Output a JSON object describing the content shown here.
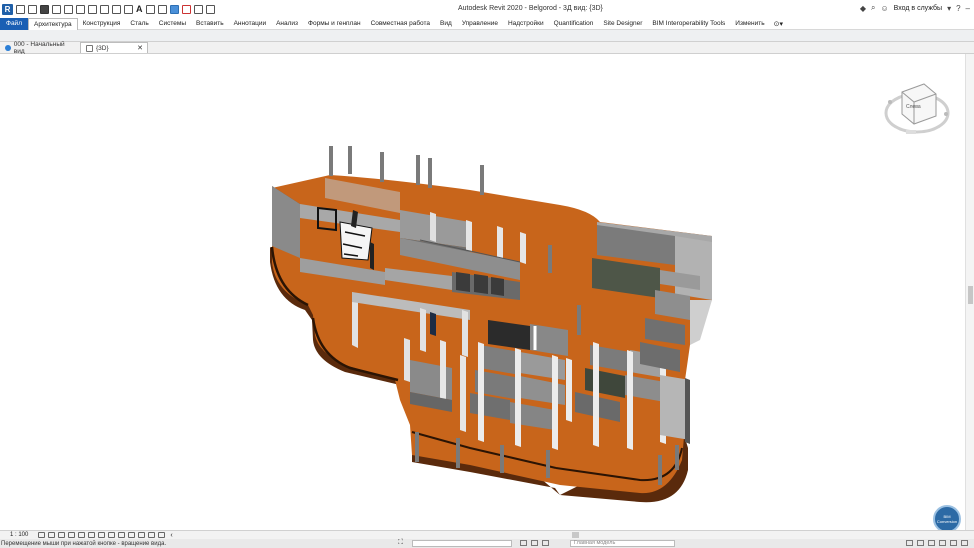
{
  "app": {
    "window_title": "Autodesk Revit 2020 - Belgorod - 3Д вид: {3D}",
    "sign_in": "Вход в службы",
    "logo_letter": "R",
    "text_tool_letter": "A"
  },
  "ribbon": {
    "file_tab": "Файл",
    "tabs": [
      "Архитектура",
      "Конструкция",
      "Сталь",
      "Системы",
      "Вставить",
      "Аннотации",
      "Анализ",
      "Формы и генплан",
      "Совместная работа",
      "Вид",
      "Управление",
      "Надстройки",
      "Quantification",
      "Site Designer",
      "BIM Interoperability Tools",
      "Изменить"
    ],
    "active_tab": "Архитектура"
  },
  "view_tabs": [
    {
      "label": "000 - Начальный вид",
      "active": false
    },
    {
      "label": "{3D}",
      "active": true,
      "close": "✕"
    }
  ],
  "viewcube": {
    "face_label": "Слева"
  },
  "nav_badge": {
    "label": "BIM Conversion"
  },
  "view_control": {
    "scale": "1 : 100"
  },
  "status": {
    "message": "Перемещение мыши при нажатой кнопке - вращение вида.",
    "model_field": "Главная модель"
  },
  "colors": {
    "floor": "#c8651b",
    "floor_edge": "#5a2a0c",
    "wall_light": "#d9d9d9",
    "wall_mid": "#9c9c9c",
    "wall_dark": "#6d6d6d",
    "accent": "#1a5fb4"
  }
}
